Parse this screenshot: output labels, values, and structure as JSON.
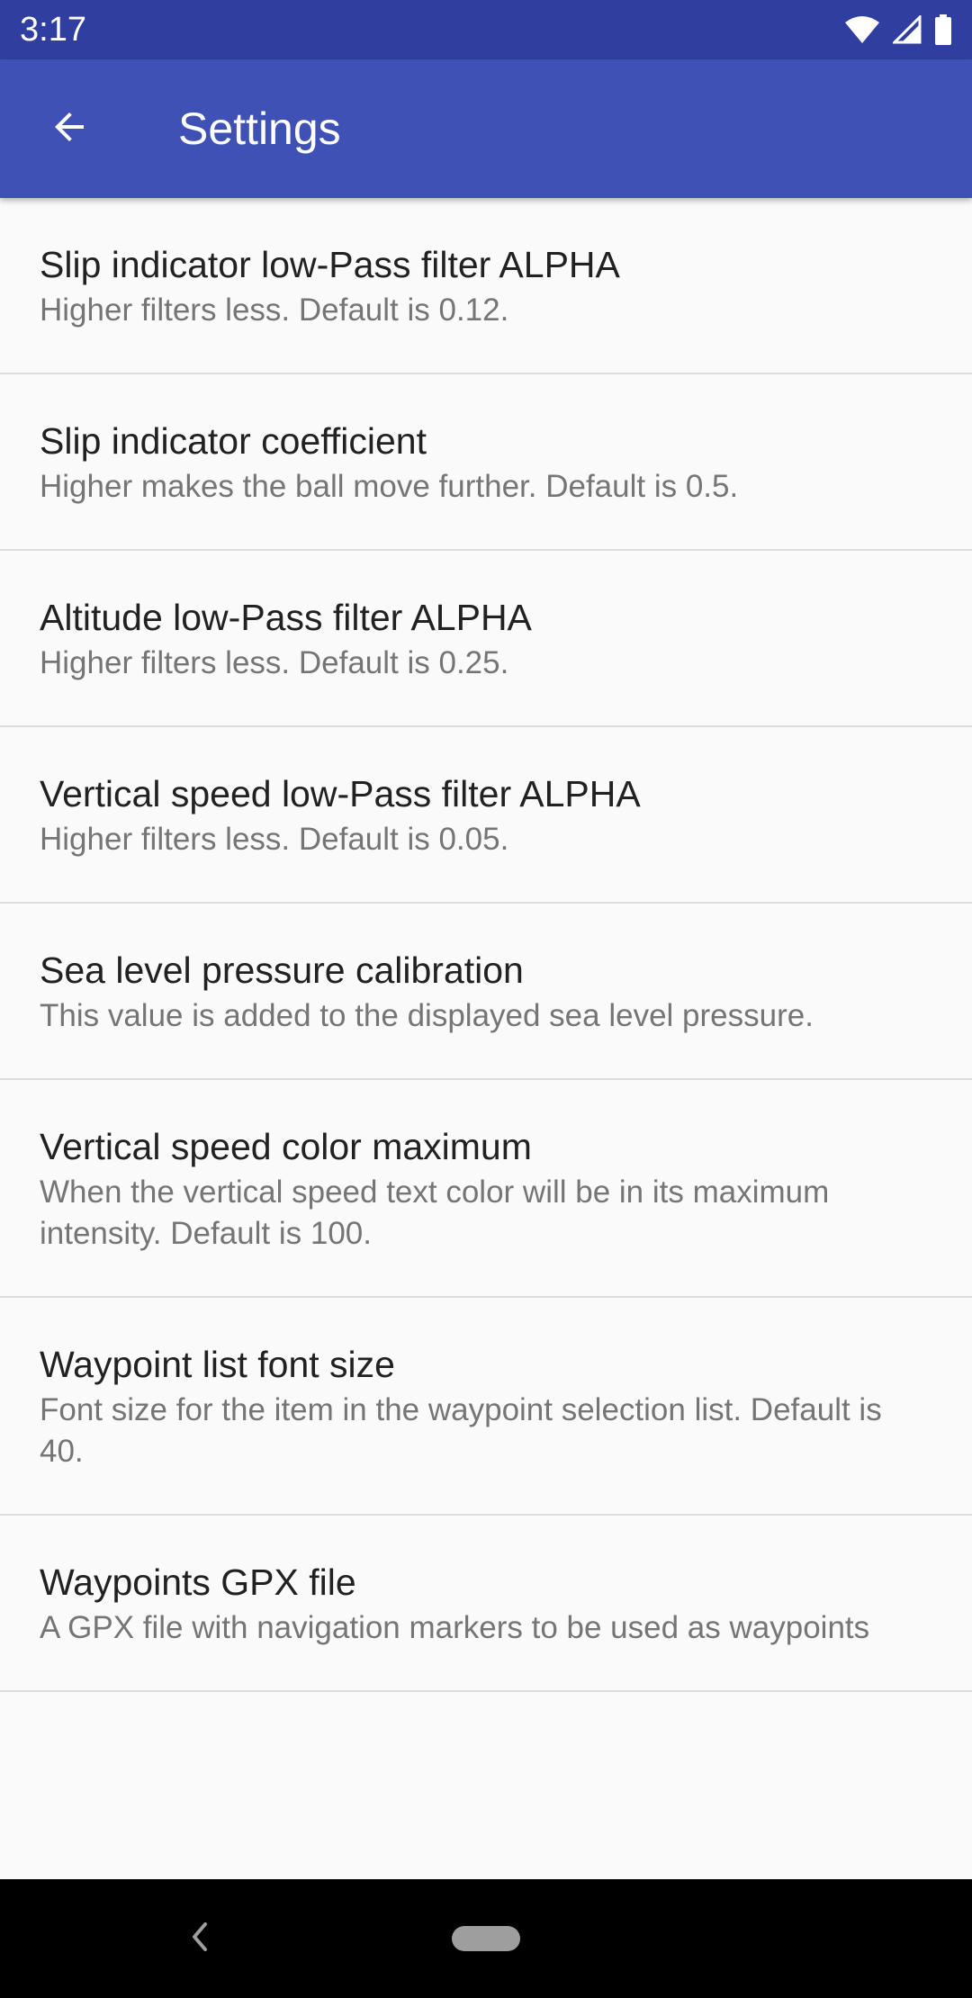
{
  "status_bar": {
    "time": "3:17",
    "icons": [
      "wifi-icon",
      "cell-signal-icon",
      "battery-icon"
    ]
  },
  "app_bar": {
    "back_icon": "arrow-back-icon",
    "title": "Settings",
    "color": "#3f51b5",
    "status_color": "#303f9f"
  },
  "preferences": [
    {
      "title": "Slip indicator low-Pass filter ALPHA",
      "summary": "Higher filters less. Default is 0.12."
    },
    {
      "title": "Slip indicator coefficient",
      "summary": "Higher makes the ball move further. Default is 0.5."
    },
    {
      "title": "Altitude low-Pass filter ALPHA",
      "summary": "Higher filters less. Default is 0.25."
    },
    {
      "title": "Vertical speed low-Pass filter ALPHA",
      "summary": "Higher filters less. Default is 0.05."
    },
    {
      "title": "Sea level pressure calibration",
      "summary": "This value is added to the displayed sea level pressure."
    },
    {
      "title": "Vertical speed color maximum",
      "summary": "When the vertical speed text color will be in its maximum intensity. Default is 100."
    },
    {
      "title": "Waypoint list font size",
      "summary": "Font size for the item in the waypoint selection list. Default is 40."
    },
    {
      "title": "Waypoints GPX file",
      "summary": "A GPX file with navigation markers to be used as waypoints"
    }
  ],
  "nav_bar": {
    "back_icon": "nav-back-icon",
    "home_icon": "home-pill-icon"
  }
}
